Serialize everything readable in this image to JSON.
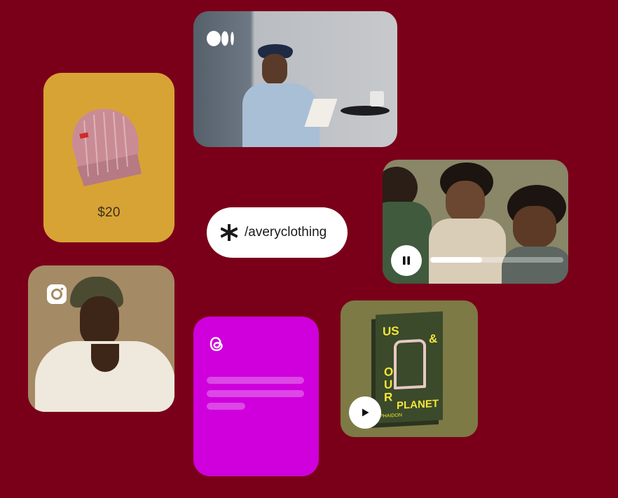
{
  "colors": {
    "background": "#7a0019",
    "beanie_card": "#d8a335",
    "threads_card": "#cf00dc",
    "book_card": "#7d7a46",
    "pill": "#ffffff"
  },
  "medium_card": {
    "icon": "medium-logo-icon"
  },
  "beanie_card": {
    "price": "$20"
  },
  "link_pill": {
    "icon": "linktree-asterisk-icon",
    "handle": "/averyclothing"
  },
  "video_card": {
    "icon": "pause-icon",
    "progress": 0.39
  },
  "instagram_card": {
    "icon": "instagram-icon"
  },
  "threads_card": {
    "icon": "threads-icon",
    "line_count": 3
  },
  "book_card": {
    "icon": "play-icon",
    "cover_words": [
      "US",
      "&",
      "O",
      "U",
      "R",
      "PLANET"
    ],
    "publisher": "PHAIDON"
  }
}
